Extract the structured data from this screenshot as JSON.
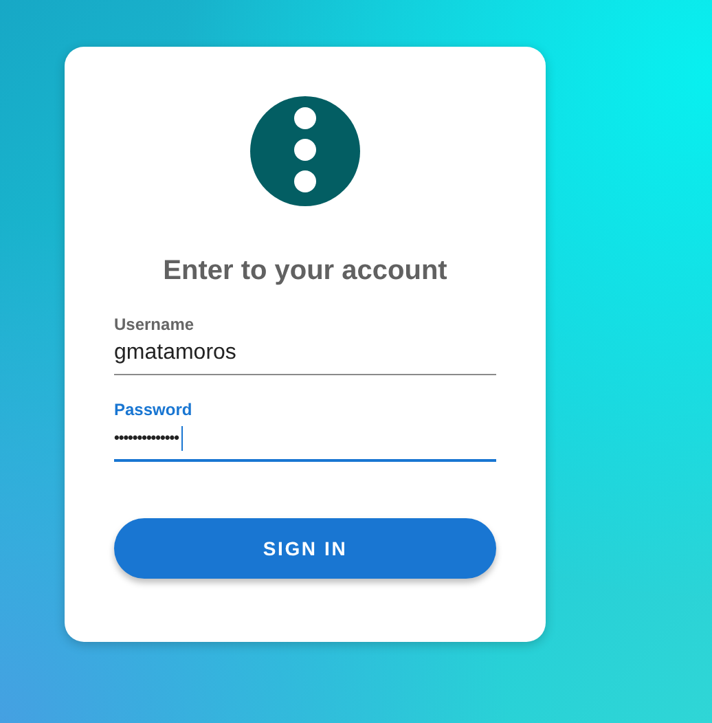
{
  "title": "Enter to your account",
  "fields": [
    {
      "label": "Username",
      "value": "gmatamoros",
      "kind": "text",
      "focused": false
    },
    {
      "label": "Password",
      "value": "••••••••••••••",
      "kind": "password",
      "focused": true
    }
  ],
  "button": {
    "label": "SIGN IN"
  }
}
